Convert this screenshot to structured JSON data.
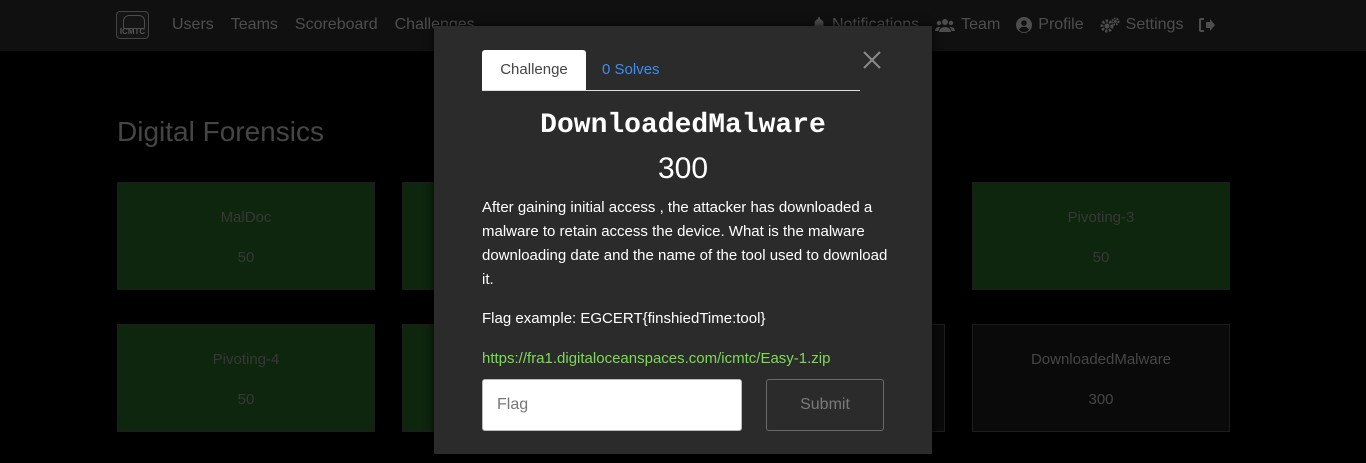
{
  "navbar": {
    "logo_text": "ICMTC",
    "left_links": [
      "Users",
      "Teams",
      "Scoreboard",
      "Challenges"
    ],
    "right_items": [
      {
        "label": "Notifications",
        "icon": "bell-icon"
      },
      {
        "label": "Team",
        "icon": "users-icon"
      },
      {
        "label": "Profile",
        "icon": "user-circle-icon"
      },
      {
        "label": "Settings",
        "icon": "cogs-icon"
      },
      {
        "label": "",
        "icon": "logout-icon"
      }
    ]
  },
  "category": {
    "title": "Digital Forensics"
  },
  "cards": [
    {
      "name": "MalDoc",
      "value": "50",
      "state": "solved"
    },
    {
      "name": "",
      "value": "",
      "state": "solved"
    },
    {
      "name": "Pivoting-3",
      "value": "50",
      "state": "solved"
    },
    {
      "name": "Pivoting-4",
      "value": "50",
      "state": "solved"
    },
    {
      "name": "",
      "value": "",
      "state": "solved"
    },
    {
      "name": "",
      "value": "",
      "state": "unsolved"
    },
    {
      "name": "DownloadedMalware",
      "value": "300",
      "state": "unsolved"
    }
  ],
  "modal": {
    "tab_challenge": "Challenge",
    "tab_solves": "0 Solves",
    "name": "DownloadedMalware",
    "value": "300",
    "description": "After gaining initial access , the attacker has downloaded a malware to retain access the device. What is the malware downloading date and the name of the tool used to download it.",
    "flag_example": "Flag example: EGCERT{finshiedTime:tool}",
    "link": "https://fra1.digitaloceanspaces.com/icmtc/Easy-1.zip",
    "flag_placeholder": "Flag",
    "submit_label": "Submit"
  },
  "colors": {
    "navbar_bg": "#212121",
    "solved_card": "#1a4d1a",
    "unsolved_card": "#141414",
    "modal_bg": "#2b2b2b",
    "link_blue": "#3a8ef0",
    "link_green": "#7ed957"
  }
}
